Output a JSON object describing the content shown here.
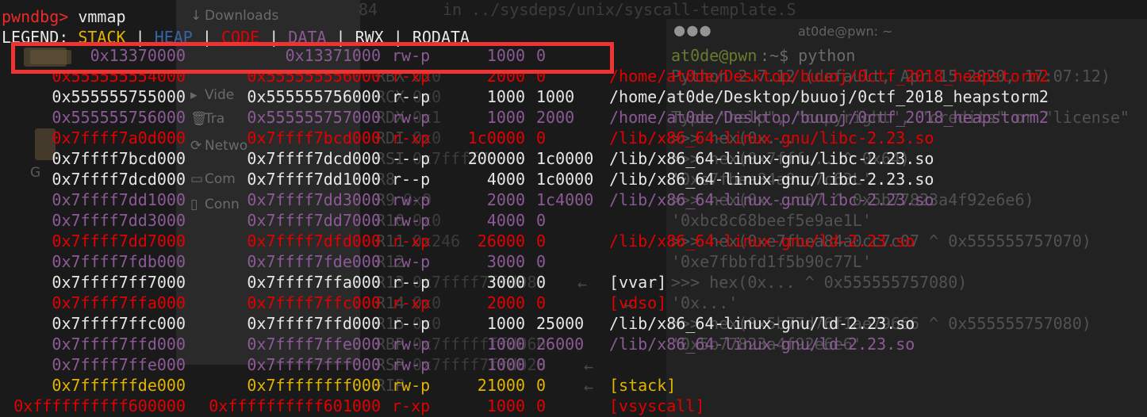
{
  "file_manager": {
    "items": [
      {
        "icon": "download-icon",
        "glyph": "↓",
        "label": "Downloads"
      },
      {
        "icon": "video-icon",
        "glyph": "▸",
        "label": "Vide"
      },
      {
        "icon": "trash-icon",
        "glyph": "🗑",
        "label": "Tra"
      },
      {
        "icon": "network-icon",
        "glyph": "⟳",
        "label": "Netwo"
      },
      {
        "icon": "computer-icon",
        "glyph": "▭",
        "label": "Com"
      },
      {
        "icon": "connect-icon",
        "glyph": "▯",
        "label": "Conn"
      }
    ],
    "folder_label": "G"
  },
  "gdb_pane": {
    "line_number": "84",
    "source_text": "in ../sysdeps/unix/syscall-template.S",
    "registers": [
      "RBX",
      "RCX",
      "RDX",
      "RDI",
      "RSI",
      "R8",
      "R9",
      "R10",
      "R11",
      "R12",
      "R13",
      "R14",
      "R15",
      "RBP",
      "RSP",
      "RIP"
    ],
    "values": {
      "RBX": "0x0",
      "RCX": "0x0",
      "RDX": "0x1",
      "RDI": "0x0",
      "RSI": "0x7ffff7",
      "R9": "0x9",
      "R10": "0x0",
      "R11": "0x246",
      "R12": "",
      "R13": "0x7ffff7ffd080",
      "R14": "0x0",
      "R15": "0x0",
      "RBP": "0x7fffffffd060",
      "RSP": "0x7ffff7ffd028",
      "RIP": ""
    }
  },
  "python_terminal": {
    "title": "at0de@pwn: ~",
    "prompt_user": "at0de@pwn",
    "prompt_rest": ":~$ python",
    "lines": [
      "Python 2.7.12 (default, Apr 15 2020, 17:07:12)",
      "",
      "Type \"help\", \"copyright\", \"credits\" or \"license\"",
      ">>> hex(0x...",
      ">>> hex(0x7fff... ^ 0x64)",
      "'0xe7fbea84a0cc7c63L'",
      ">>> hex(0x...c07 ^ 0x5b77823a4f92e6e6)",
      "'0xbc8c68beef5e9ae1L'",
      ">>> hex(0xe7fbea84a0cc7c07 ^ 0x555555757070)",
      "'0xe7fbbfd1f5b90c77L'",
      ">>> hex(0x... ^ 0x555555757080)",
      "'0x...'",
      ">>> hex(0x5b77d76f1ae79666 ^ 0x555555757080)",
      "'0x5b77823a4f92e6e6'"
    ]
  },
  "vmmap": {
    "prompt": "pwndbg>",
    "command": "vmmap",
    "legend": {
      "label": "LEGEND:",
      "stack": "STACK",
      "heap": "HEAP",
      "code": "CODE",
      "data": "DATA",
      "rwx": "RWX",
      "rodata": "RODATA",
      "separator": " | "
    },
    "highlighted_row_index": 0,
    "rows": [
      {
        "kind": "anon",
        "start": "0x13370000",
        "end": "0x13371000",
        "perm": "rw-p",
        "size": "1000",
        "offset": "0",
        "path": ""
      },
      {
        "kind": "code",
        "start": "0x555555554000",
        "end": "0x555555556000",
        "perm": "r-xp",
        "size": "2000",
        "offset": "0",
        "path": "/home/at0de/Desktop/buuoj/0ctf_2018_heapstorm2"
      },
      {
        "kind": "ro",
        "start": "0x555555755000",
        "end": "0x555555756000",
        "perm": "r--p",
        "size": "1000",
        "offset": "1000",
        "path": "/home/at0de/Desktop/buuoj/0ctf_2018_heapstorm2"
      },
      {
        "kind": "data",
        "start": "0x555555756000",
        "end": "0x555555757000",
        "perm": "rw-p",
        "size": "1000",
        "offset": "2000",
        "path": "/home/at0de/Desktop/buuoj/0ctf_2018_heapstorm2"
      },
      {
        "kind": "code",
        "start": "0x7ffff7a0d000",
        "end": "0x7ffff7bcd000",
        "perm": "r-xp",
        "size": "1c0000",
        "offset": "0",
        "path": "/lib/x86_64-linux-gnu/libc-2.23.so"
      },
      {
        "kind": "ro",
        "start": "0x7ffff7bcd000",
        "end": "0x7ffff7dcd000",
        "perm": "---p",
        "size": "200000",
        "offset": "1c0000",
        "path": "/lib/x86_64-linux-gnu/libc-2.23.so"
      },
      {
        "kind": "ro",
        "start": "0x7ffff7dcd000",
        "end": "0x7ffff7dd1000",
        "perm": "r--p",
        "size": "4000",
        "offset": "1c0000",
        "path": "/lib/x86_64-linux-gnu/libc-2.23.so"
      },
      {
        "kind": "data",
        "start": "0x7ffff7dd1000",
        "end": "0x7ffff7dd3000",
        "perm": "rw-p",
        "size": "2000",
        "offset": "1c4000",
        "path": "/lib/x86_64-linux-gnu/libc-2.23.so"
      },
      {
        "kind": "data",
        "start": "0x7ffff7dd3000",
        "end": "0x7ffff7dd7000",
        "perm": "rw-p",
        "size": "4000",
        "offset": "0",
        "path": ""
      },
      {
        "kind": "code",
        "start": "0x7ffff7dd7000",
        "end": "0x7ffff7dfd000",
        "perm": "r-xp",
        "size": "26000",
        "offset": "0",
        "path": "/lib/x86_64-linux-gnu/ld-2.23.so"
      },
      {
        "kind": "data",
        "start": "0x7ffff7fdb000",
        "end": "0x7ffff7fde000",
        "perm": "rw-p",
        "size": "3000",
        "offset": "0",
        "path": ""
      },
      {
        "kind": "ro",
        "start": "0x7ffff7ff7000",
        "end": "0x7ffff7ffa000",
        "perm": "r--p",
        "size": "3000",
        "offset": "0",
        "path": "[vvar]"
      },
      {
        "kind": "code",
        "start": "0x7ffff7ffa000",
        "end": "0x7ffff7ffc000",
        "perm": "r-xp",
        "size": "2000",
        "offset": "0",
        "path": "[vdso]"
      },
      {
        "kind": "ro",
        "start": "0x7ffff7ffc000",
        "end": "0x7ffff7ffd000",
        "perm": "r--p",
        "size": "1000",
        "offset": "25000",
        "path": "/lib/x86_64-linux-gnu/ld-2.23.so"
      },
      {
        "kind": "data",
        "start": "0x7ffff7ffd000",
        "end": "0x7ffff7ffe000",
        "perm": "rw-p",
        "size": "1000",
        "offset": "26000",
        "path": "/lib/x86_64-linux-gnu/ld-2.23.so"
      },
      {
        "kind": "data",
        "start": "0x7ffff7ffe000",
        "end": "0x7ffff7fff000",
        "perm": "rw-p",
        "size": "1000",
        "offset": "0",
        "path": ""
      },
      {
        "kind": "stack",
        "start": "0x7ffffffde000",
        "end": "0x7ffffffff000",
        "perm": "rw-p",
        "size": "21000",
        "offset": "0",
        "path": "[stack]"
      },
      {
        "kind": "code",
        "start": "0xffffffffff600000",
        "end": "0xffffffffff601000",
        "perm": "r-xp",
        "size": "1000",
        "offset": "0",
        "path": "[vsyscall]"
      }
    ]
  },
  "colors": {
    "code": "#e30000",
    "readonly": "#e6e6e6",
    "data": "#8c5a96",
    "stack": "#e1b400",
    "heap": "#3465a4",
    "highlight_box": "#ee3333",
    "prompt": "#ef2929"
  }
}
